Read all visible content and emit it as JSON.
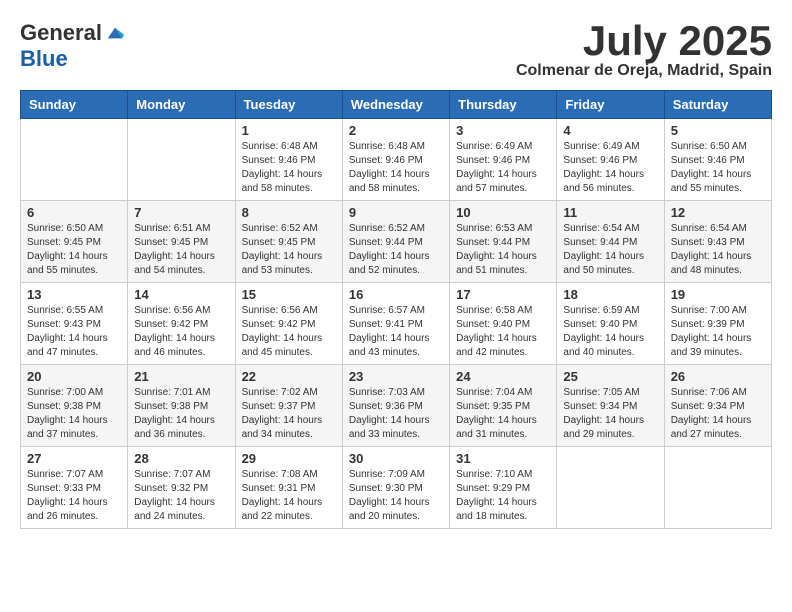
{
  "header": {
    "logo": {
      "general": "General",
      "blue": "Blue"
    },
    "title": "July 2025",
    "subtitle": "Colmenar de Oreja, Madrid, Spain"
  },
  "calendar": {
    "days_of_week": [
      "Sunday",
      "Monday",
      "Tuesday",
      "Wednesday",
      "Thursday",
      "Friday",
      "Saturday"
    ],
    "weeks": [
      [
        {
          "day": "",
          "info": ""
        },
        {
          "day": "",
          "info": ""
        },
        {
          "day": "1",
          "info": "Sunrise: 6:48 AM\nSunset: 9:46 PM\nDaylight: 14 hours and 58 minutes."
        },
        {
          "day": "2",
          "info": "Sunrise: 6:48 AM\nSunset: 9:46 PM\nDaylight: 14 hours and 58 minutes."
        },
        {
          "day": "3",
          "info": "Sunrise: 6:49 AM\nSunset: 9:46 PM\nDaylight: 14 hours and 57 minutes."
        },
        {
          "day": "4",
          "info": "Sunrise: 6:49 AM\nSunset: 9:46 PM\nDaylight: 14 hours and 56 minutes."
        },
        {
          "day": "5",
          "info": "Sunrise: 6:50 AM\nSunset: 9:46 PM\nDaylight: 14 hours and 55 minutes."
        }
      ],
      [
        {
          "day": "6",
          "info": "Sunrise: 6:50 AM\nSunset: 9:45 PM\nDaylight: 14 hours and 55 minutes."
        },
        {
          "day": "7",
          "info": "Sunrise: 6:51 AM\nSunset: 9:45 PM\nDaylight: 14 hours and 54 minutes."
        },
        {
          "day": "8",
          "info": "Sunrise: 6:52 AM\nSunset: 9:45 PM\nDaylight: 14 hours and 53 minutes."
        },
        {
          "day": "9",
          "info": "Sunrise: 6:52 AM\nSunset: 9:44 PM\nDaylight: 14 hours and 52 minutes."
        },
        {
          "day": "10",
          "info": "Sunrise: 6:53 AM\nSunset: 9:44 PM\nDaylight: 14 hours and 51 minutes."
        },
        {
          "day": "11",
          "info": "Sunrise: 6:54 AM\nSunset: 9:44 PM\nDaylight: 14 hours and 50 minutes."
        },
        {
          "day": "12",
          "info": "Sunrise: 6:54 AM\nSunset: 9:43 PM\nDaylight: 14 hours and 48 minutes."
        }
      ],
      [
        {
          "day": "13",
          "info": "Sunrise: 6:55 AM\nSunset: 9:43 PM\nDaylight: 14 hours and 47 minutes."
        },
        {
          "day": "14",
          "info": "Sunrise: 6:56 AM\nSunset: 9:42 PM\nDaylight: 14 hours and 46 minutes."
        },
        {
          "day": "15",
          "info": "Sunrise: 6:56 AM\nSunset: 9:42 PM\nDaylight: 14 hours and 45 minutes."
        },
        {
          "day": "16",
          "info": "Sunrise: 6:57 AM\nSunset: 9:41 PM\nDaylight: 14 hours and 43 minutes."
        },
        {
          "day": "17",
          "info": "Sunrise: 6:58 AM\nSunset: 9:40 PM\nDaylight: 14 hours and 42 minutes."
        },
        {
          "day": "18",
          "info": "Sunrise: 6:59 AM\nSunset: 9:40 PM\nDaylight: 14 hours and 40 minutes."
        },
        {
          "day": "19",
          "info": "Sunrise: 7:00 AM\nSunset: 9:39 PM\nDaylight: 14 hours and 39 minutes."
        }
      ],
      [
        {
          "day": "20",
          "info": "Sunrise: 7:00 AM\nSunset: 9:38 PM\nDaylight: 14 hours and 37 minutes."
        },
        {
          "day": "21",
          "info": "Sunrise: 7:01 AM\nSunset: 9:38 PM\nDaylight: 14 hours and 36 minutes."
        },
        {
          "day": "22",
          "info": "Sunrise: 7:02 AM\nSunset: 9:37 PM\nDaylight: 14 hours and 34 minutes."
        },
        {
          "day": "23",
          "info": "Sunrise: 7:03 AM\nSunset: 9:36 PM\nDaylight: 14 hours and 33 minutes."
        },
        {
          "day": "24",
          "info": "Sunrise: 7:04 AM\nSunset: 9:35 PM\nDaylight: 14 hours and 31 minutes."
        },
        {
          "day": "25",
          "info": "Sunrise: 7:05 AM\nSunset: 9:34 PM\nDaylight: 14 hours and 29 minutes."
        },
        {
          "day": "26",
          "info": "Sunrise: 7:06 AM\nSunset: 9:34 PM\nDaylight: 14 hours and 27 minutes."
        }
      ],
      [
        {
          "day": "27",
          "info": "Sunrise: 7:07 AM\nSunset: 9:33 PM\nDaylight: 14 hours and 26 minutes."
        },
        {
          "day": "28",
          "info": "Sunrise: 7:07 AM\nSunset: 9:32 PM\nDaylight: 14 hours and 24 minutes."
        },
        {
          "day": "29",
          "info": "Sunrise: 7:08 AM\nSunset: 9:31 PM\nDaylight: 14 hours and 22 minutes."
        },
        {
          "day": "30",
          "info": "Sunrise: 7:09 AM\nSunset: 9:30 PM\nDaylight: 14 hours and 20 minutes."
        },
        {
          "day": "31",
          "info": "Sunrise: 7:10 AM\nSunset: 9:29 PM\nDaylight: 14 hours and 18 minutes."
        },
        {
          "day": "",
          "info": ""
        },
        {
          "day": "",
          "info": ""
        }
      ]
    ]
  }
}
